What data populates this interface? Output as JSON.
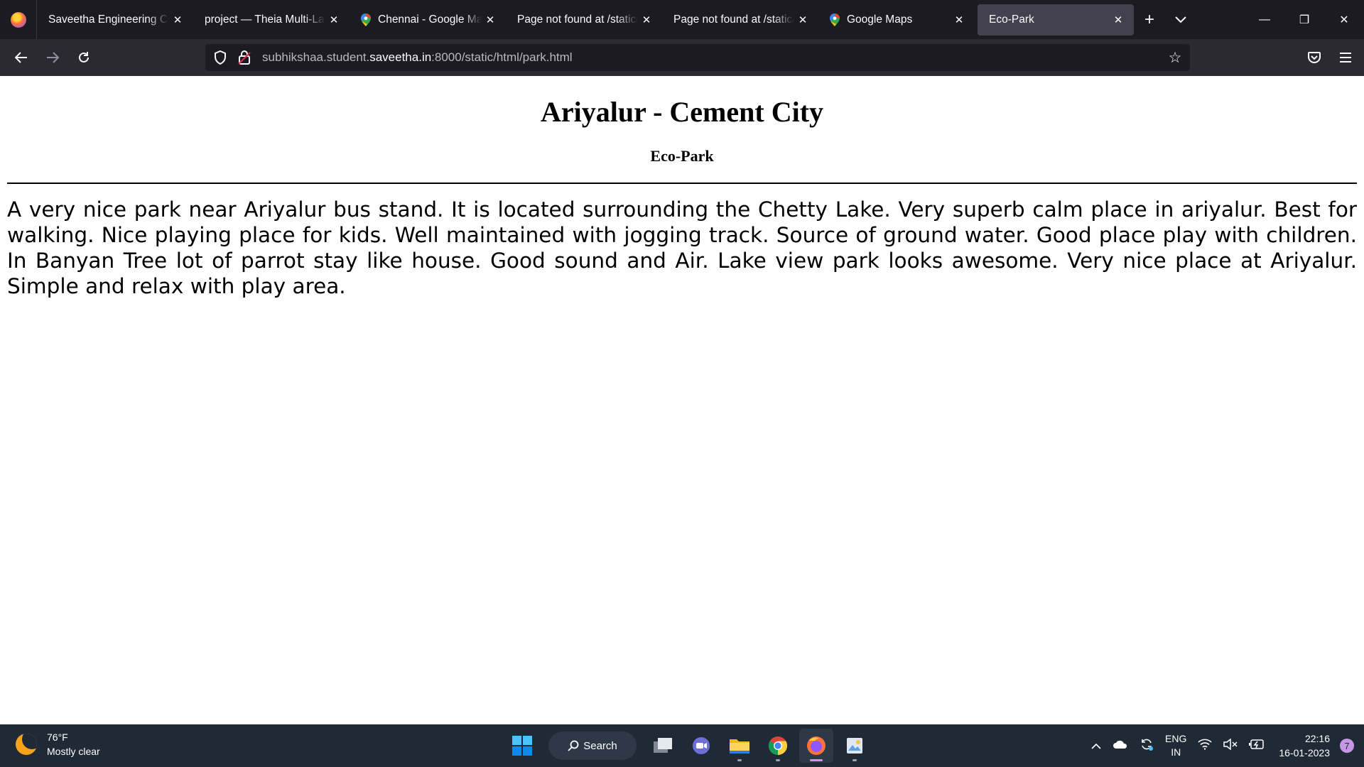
{
  "browser": {
    "tabs": [
      {
        "title": "Saveetha Engineering Colle",
        "icon": "none"
      },
      {
        "title": "project — Theia Multi-Lang",
        "icon": "none"
      },
      {
        "title": "Chennai - Google Maps",
        "icon": "maps-pin-icon"
      },
      {
        "title": "Page not found at /static/ht",
        "icon": "none"
      },
      {
        "title": "Page not found at /static/ht",
        "icon": "none"
      },
      {
        "title": "Google Maps",
        "icon": "maps-pin-icon"
      },
      {
        "title": "Eco-Park",
        "icon": "none",
        "active": true
      }
    ],
    "url": {
      "prefix": "subhikshaa.student.",
      "domain": "saveetha.in",
      "suffix": ":8000/static/html/park.html"
    }
  },
  "page": {
    "title": "Ariyalur - Cement City",
    "subtitle": "Eco-Park",
    "body": "A very nice park near Ariyalur bus stand. It is located surrounding the Chetty Lake. Very superb calm place in ariyalur. Best for walking. Nice playing place for kids. Well maintained with jogging track. Source of ground water. Good place play with children. In Banyan Tree lot of parrot stay like house. Good sound and Air. Lake view park looks awesome. Very nice place at Ariyalur. Simple and relax with play area."
  },
  "taskbar": {
    "weather_temp": "76°F",
    "weather_desc": "Mostly clear",
    "search_label": "Search",
    "lang_top": "ENG",
    "lang_bottom": "IN",
    "time": "22:16",
    "date": "16-01-2023",
    "notification_count": "7"
  },
  "colors": {
    "tab_bar": "#1c1b22",
    "nav_bar": "#2b2a33",
    "active_tab": "#42414d",
    "taskbar": "#1f2a36"
  }
}
